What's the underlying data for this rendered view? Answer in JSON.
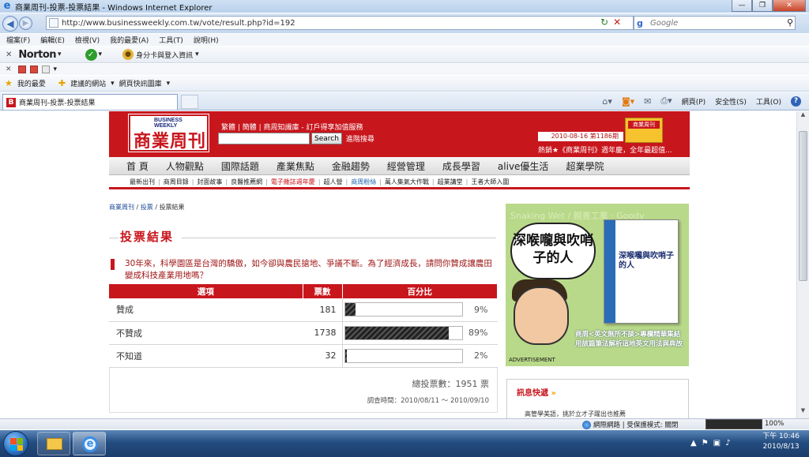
{
  "window": {
    "title": "商業周刊-投票-投票結果 - Windows Internet Explorer"
  },
  "address": {
    "url": "http://www.businessweekly.com.tw/vote/result.php?id=192",
    "search_placeholder": "Google"
  },
  "menu": [
    "檔案(F)",
    "編輯(E)",
    "檢視(V)",
    "我的最愛(A)",
    "工具(T)",
    "說明(H)"
  ],
  "norton": {
    "brand": "Norton",
    "id_label": "身分卡與登入資訊"
  },
  "favorites": {
    "label": "我的最愛",
    "suggested": "建議的網站",
    "webslice": "網頁快訊圖庫"
  },
  "tab": {
    "title": "商業周刊-投票-投票結果",
    "favicon": "B"
  },
  "cmd": {
    "page": "網頁(P)",
    "safety": "安全性(S)",
    "tools": "工具(O)"
  },
  "site": {
    "logo_en": "BUSINESS WEEKLY",
    "logo_cn": "商業周刊",
    "top_links": "繁體 | 簡體 | 商周知識庫 - 訂戶得享加值服務",
    "search_button": "Search",
    "advanced_search": "進階搜尋",
    "issue": "2010-08-16 第1186期",
    "marquee": "熱銷★《商業周刊》週年慶，全年最超值...",
    "magazine_label": "商業周刊",
    "main_nav": [
      "首 頁",
      "人物觀點",
      "國際話題",
      "產業焦點",
      "金融趨勢",
      "經營管理",
      "成長學習",
      "alive優生活",
      "超業學院"
    ],
    "sub_nav": [
      "最新出刊",
      "商周目錄",
      "封面故事",
      "良醫推薦網",
      "電子雜誌週年慶",
      "超人營",
      "商周粉絲",
      "萬人集氣大作戰",
      "超業講堂",
      "王者大師入圍"
    ]
  },
  "breadcrumb": [
    "商業周刊",
    "投票",
    "投票結果"
  ],
  "vote": {
    "title": "投票結果",
    "question": "30年來，科學園區是台灣的驕傲，如今卻與農民搶地、爭議不斷。為了經濟成長，請問你贊成讓農田變成科技產業用地嗎？",
    "headers": {
      "option": "選項",
      "count": "票數",
      "percent": "百分比"
    },
    "rows": [
      {
        "option": "贊成",
        "count": "181",
        "percent": "9%",
        "fraction": 0.09
      },
      {
        "option": "不贊成",
        "count": "1738",
        "percent": "89%",
        "fraction": 0.89
      },
      {
        "option": "不知道",
        "count": "32",
        "percent": "2%",
        "fraction": 0.02
      }
    ],
    "total": "總投票數：1951 票",
    "period": "調查時間：2010/08/11 ～ 2010/09/10"
  },
  "ad": {
    "bg_text": "Snaking Wet / 親善工業 · Goody",
    "bubble": "深喉嚨與吹哨子的人",
    "book_title": "深喉嚨與吹哨子的人",
    "caption": "商周<英文無所不談>專欄精華集結 用該篇筆法解析這地英文用法與典故",
    "label": "ADVERTISEMENT"
  },
  "news": {
    "title": "訊息快遞",
    "item": "高管學美語，挑於立才子躍出也推薦"
  },
  "status": {
    "zone": "網際網路 | 受保護模式: 關閉",
    "zoom": "100%"
  },
  "clock": {
    "time": "下午 10:46",
    "date": "2010/8/13"
  }
}
